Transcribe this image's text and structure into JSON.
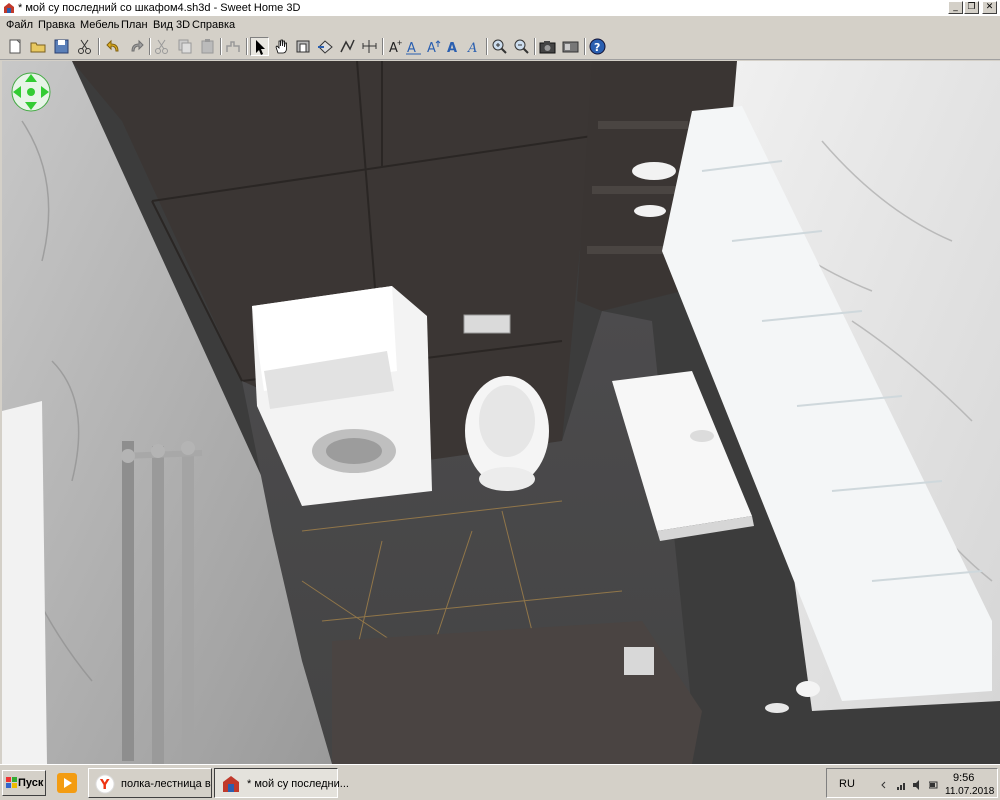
{
  "window": {
    "title": "* мой су последний со шкафом4.sh3d - Sweet Home 3D",
    "minimize": "_",
    "restore": "❐",
    "close": "✕"
  },
  "menu": {
    "items": [
      "Файл",
      "Правка",
      "Мебель",
      "План",
      "Вид 3D",
      "Справка"
    ]
  },
  "toolbar": {
    "buttons": [
      "new-icon",
      "open-icon",
      "save-icon",
      "cut-icon",
      "undo-icon",
      "redo-icon",
      "cut-icon",
      "copy-icon",
      "paste-icon",
      "add-furniture-icon",
      "select-icon",
      "pan-icon",
      "create-walls-icon",
      "create-rooms-icon",
      "create-polylines-icon",
      "create-dimensions-icon",
      "add-text-icon",
      "text-style-icon",
      "bold-icon",
      "italic-icon",
      "zoom-in-icon",
      "zoom-out-icon",
      "photo-icon",
      "video-icon",
      "help-icon"
    ]
  },
  "taskbar": {
    "start_label": "Пуск",
    "tasks": [
      {
        "label": "полка-лестница в в..."
      },
      {
        "label": "* мой су последни..."
      }
    ],
    "language": "RU",
    "time": "9:56",
    "date": "11.07.2018"
  },
  "colors": {
    "window_bg": "#d4d0c8",
    "tile_dark": "#3b3634",
    "floor": "#4a4a4c",
    "marble": "#dcdcdc",
    "accent_blue": "#2a5fb0"
  }
}
